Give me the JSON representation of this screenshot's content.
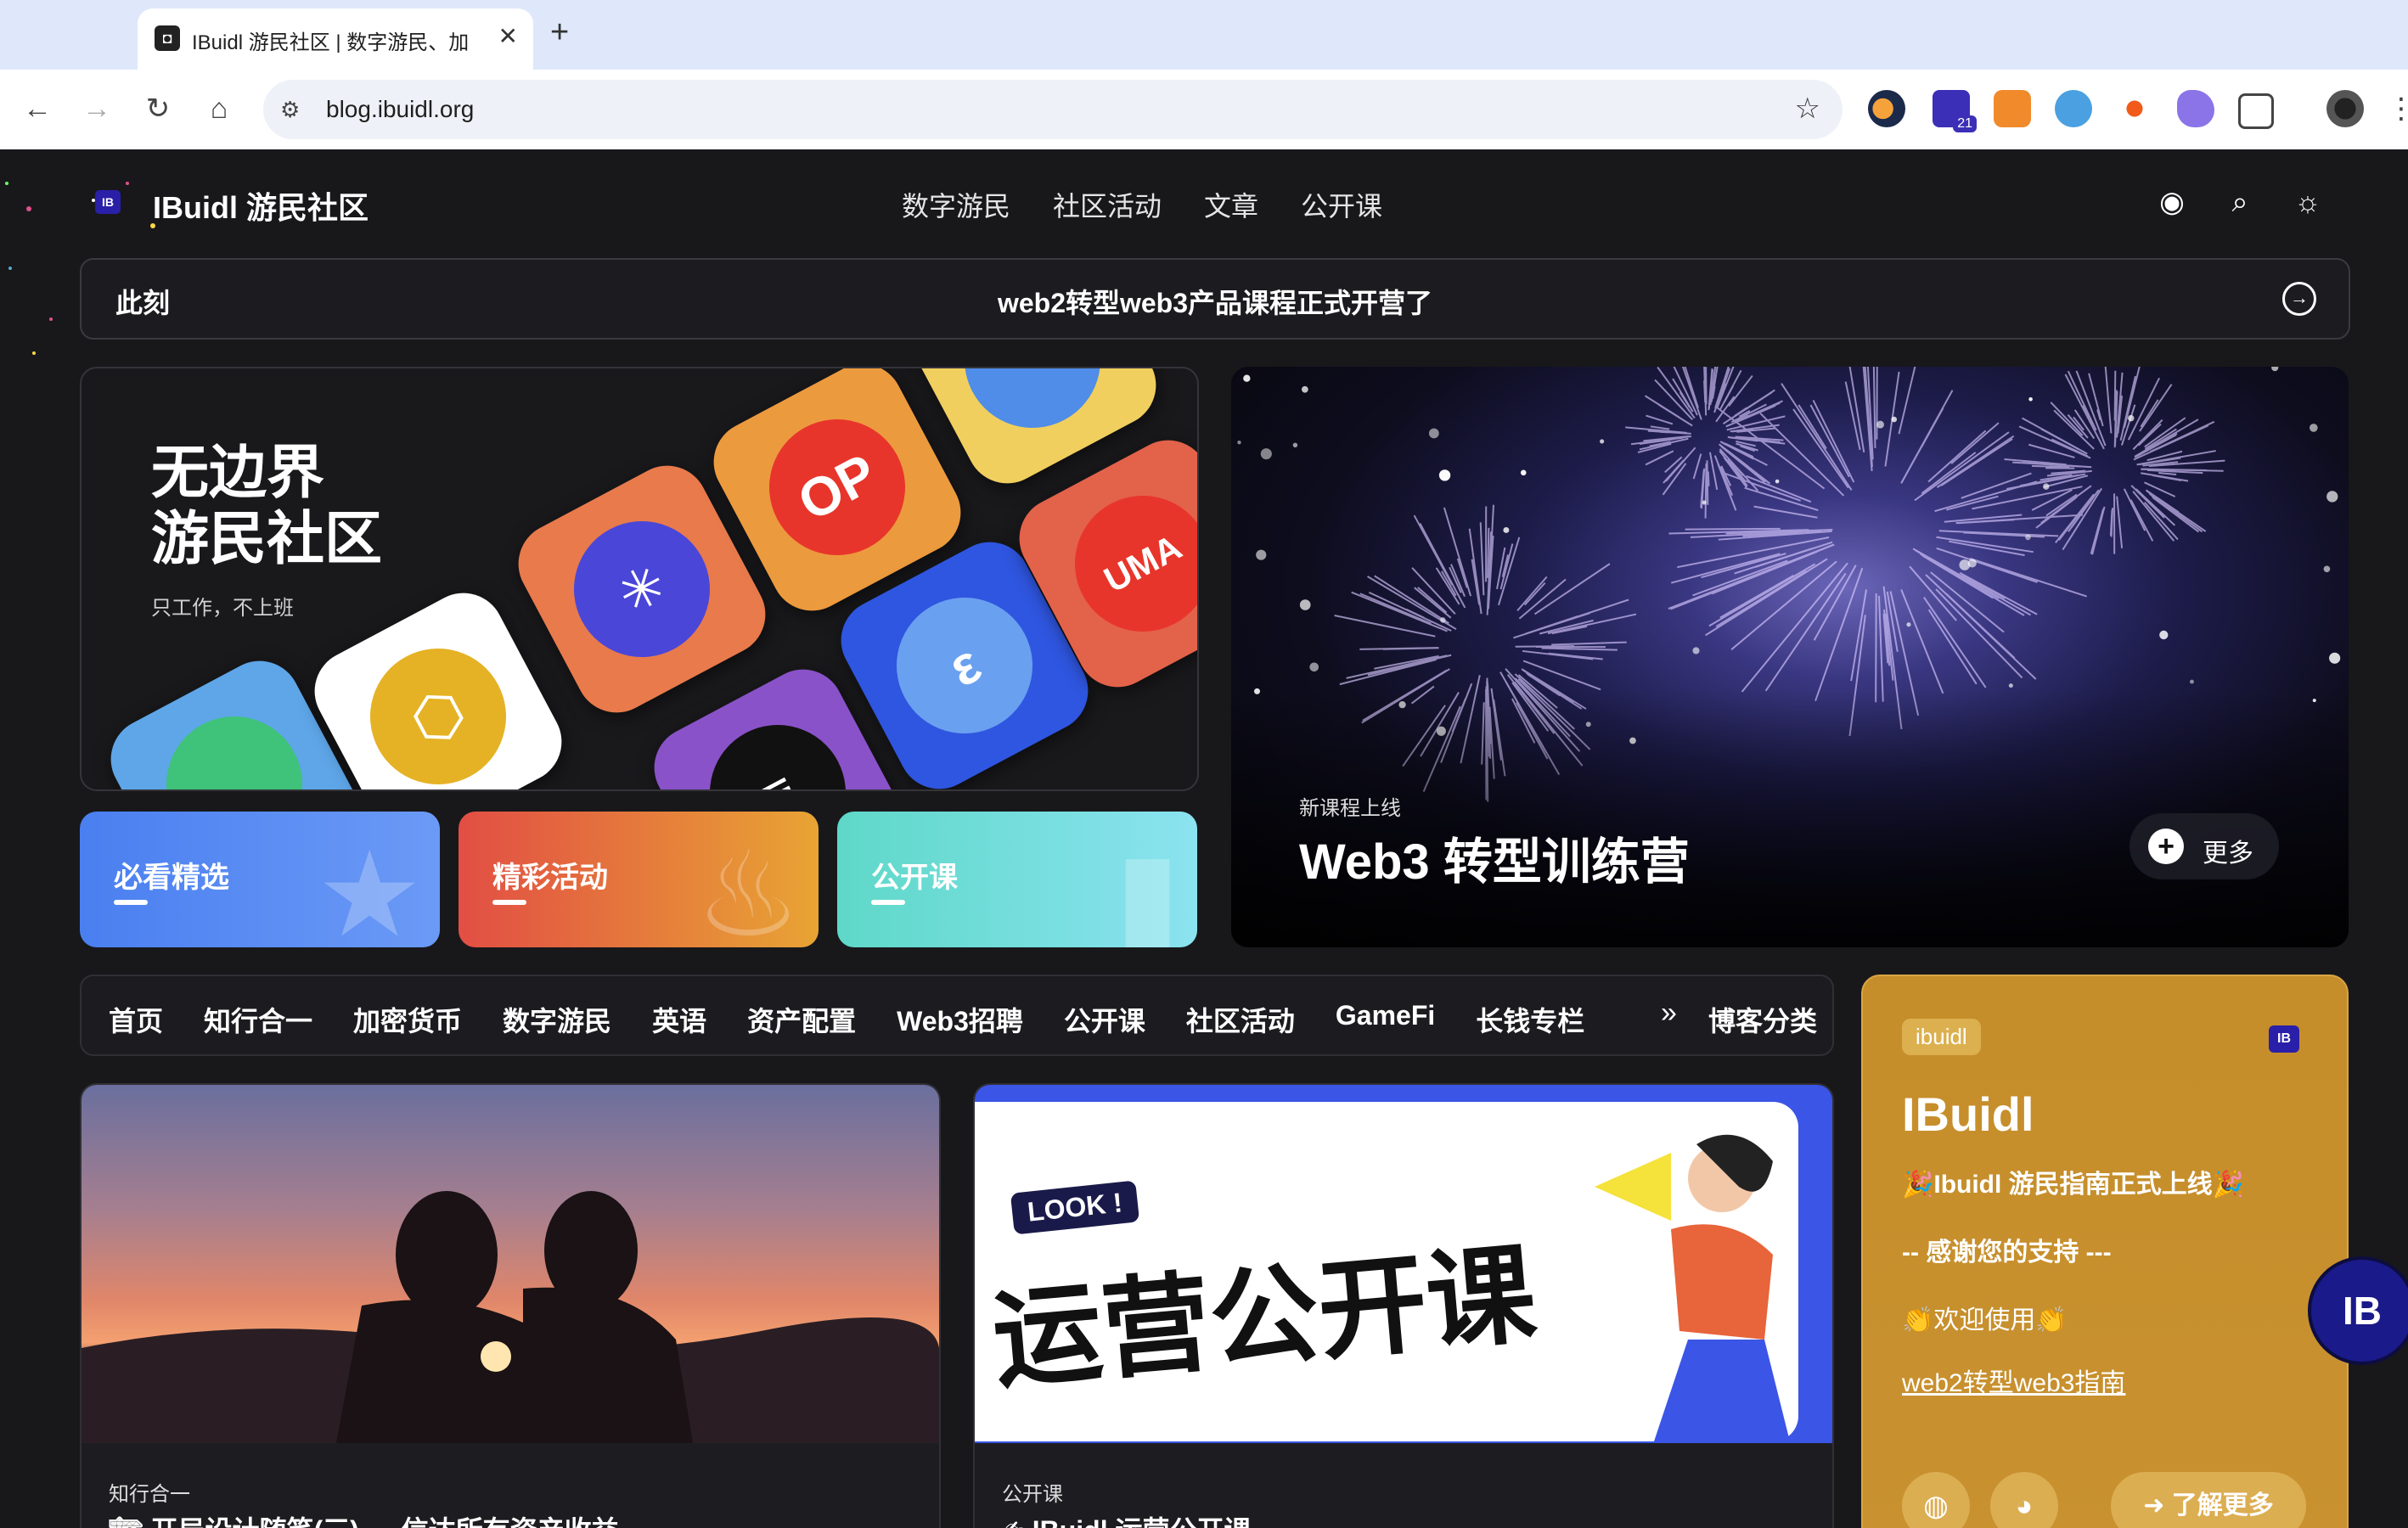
{
  "browser": {
    "tab_title": "IBuidl 游民社区 | 数字游民、加",
    "url": "blog.ibuidl.org",
    "ext_badge": "21"
  },
  "site": {
    "logo": "IB",
    "name": "IBuidl 游民社区",
    "nav": [
      "数字游民",
      "社区活动",
      "文章",
      "公开课"
    ]
  },
  "announcement": {
    "label": "此刻",
    "text": "web2转型web3产品课程正式开营了"
  },
  "hero": {
    "title_line1": "无边界",
    "title_line2": "游民社区",
    "subtitle": "只工作，不上班",
    "tiles": [
      "OP",
      "UMA"
    ]
  },
  "quick_tiles": [
    {
      "label": "必看精选",
      "color": "#4f7ff0"
    },
    {
      "label": "精彩活动",
      "color": "#e26a3d"
    },
    {
      "label": "公开课",
      "color": "#6fd9d2"
    }
  ],
  "feature": {
    "subtitle": "新课程上线",
    "title": "Web3 转型训练营",
    "more": "更多"
  },
  "categories": [
    "首页",
    "知行合一",
    "加密货币",
    "数字游民",
    "英语",
    "资产配置",
    "Web3招聘",
    "公开课",
    "社区活动",
    "GameFi",
    "长钱专栏"
  ],
  "categories_more": "博客分类",
  "articles": [
    {
      "category": "知行合一",
      "title": "🏗 开局设计随笔(三) — 信达所有资产收益"
    },
    {
      "category": "公开课",
      "title": "✍ IBuidl 运营公开课",
      "banner_tag": "LOOK !",
      "banner_text": "运营公开课"
    }
  ],
  "promo": {
    "tag": "ibuidl",
    "logo": "IB",
    "name": "IBuidl",
    "line1": "🎉Ibuidl 游民指南正式上线🎉",
    "line2": "-- 感谢您的支持 ---",
    "line3": "👏欢迎使用👏",
    "link": "web2转型web3指南",
    "learn_more": "了解更多"
  },
  "float_badge": "IB"
}
